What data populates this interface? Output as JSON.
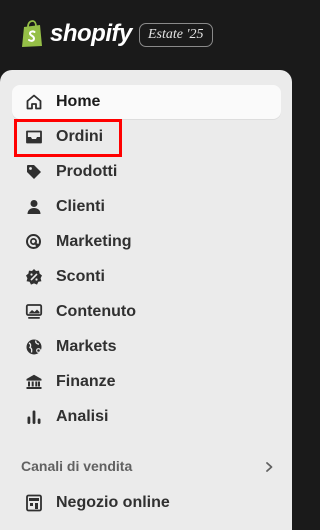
{
  "header": {
    "brand": "shopify",
    "edition": "Estate '25",
    "brand_color": "#95BF47",
    "logo_icon": "shopify-bag-icon"
  },
  "nav": {
    "items": [
      {
        "label": "Home",
        "icon": "home-icon",
        "active": true
      },
      {
        "label": "Ordini",
        "icon": "inbox-icon"
      },
      {
        "label": "Prodotti",
        "icon": "tag-icon"
      },
      {
        "label": "Clienti",
        "icon": "person-icon",
        "highlighted": true
      },
      {
        "label": "Marketing",
        "icon": "target-icon"
      },
      {
        "label": "Sconti",
        "icon": "discount-icon"
      },
      {
        "label": "Contenuto",
        "icon": "content-icon"
      },
      {
        "label": "Markets",
        "icon": "globe-icon"
      },
      {
        "label": "Finanze",
        "icon": "bank-icon"
      },
      {
        "label": "Analisi",
        "icon": "bar-chart-icon"
      }
    ]
  },
  "sales_channels": {
    "title": "Canali di vendita",
    "items": [
      {
        "label": "Negozio online",
        "icon": "store-icon"
      }
    ]
  },
  "colors": {
    "highlight": "#FF0000",
    "sidebar_bg": "#EBEBEB",
    "topbar_bg": "#1A1A1A"
  }
}
